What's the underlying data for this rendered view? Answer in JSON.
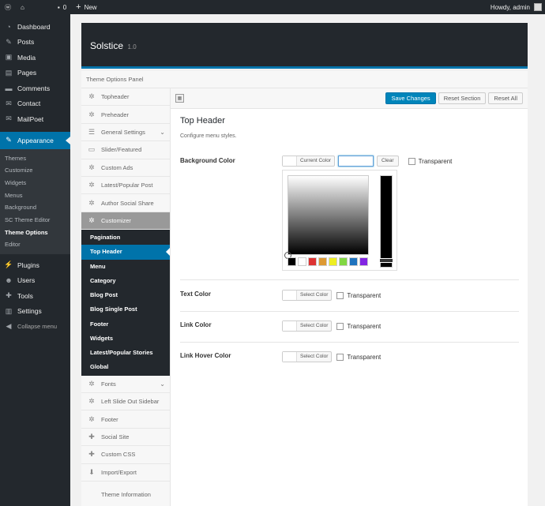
{
  "adminbar": {
    "comments_count": "0",
    "new_label": "New",
    "howdy": "Howdy, admin"
  },
  "adminmenu": {
    "top_items": [
      {
        "label": "Dashboard",
        "icon": "dashboard-icon"
      },
      {
        "label": "Posts",
        "icon": "pin-icon"
      },
      {
        "label": "Media",
        "icon": "media-icon"
      },
      {
        "label": "Pages",
        "icon": "page-icon"
      },
      {
        "label": "Comments",
        "icon": "comment-icon"
      },
      {
        "label": "Contact",
        "icon": "mail-icon"
      },
      {
        "label": "MailPoet",
        "icon": "mail-icon"
      }
    ],
    "current": {
      "label": "Appearance",
      "icon": "brush-icon"
    },
    "submenu": [
      "Themes",
      "Customize",
      "Widgets",
      "Menus",
      "Background",
      "SC Theme Editor",
      "Theme Options",
      "Editor"
    ],
    "active_submenu": "Theme Options",
    "bottom_items": [
      {
        "label": "Plugins",
        "icon": "plugin-icon"
      },
      {
        "label": "Users",
        "icon": "user-icon"
      },
      {
        "label": "Tools",
        "icon": "wrench-icon"
      },
      {
        "label": "Settings",
        "icon": "settings-icon"
      }
    ],
    "collapse": "Collapse menu"
  },
  "panel": {
    "title": "Solstice",
    "version": "1.0",
    "subtitle": "Theme Options Panel"
  },
  "options_sidebar": {
    "items_before": [
      {
        "label": "Topheader",
        "icon": "gear-icon"
      },
      {
        "label": "Preheader",
        "icon": "gear-icon"
      },
      {
        "label": "General Settings",
        "icon": "sliders-icon",
        "caret": true
      },
      {
        "label": "Slider/Featured",
        "icon": "monitor-icon"
      },
      {
        "label": "Custom Ads",
        "icon": "gear-icon"
      },
      {
        "label": "Latest/Popular Post",
        "icon": "gear-icon"
      },
      {
        "label": "Author Social Share",
        "icon": "gear-icon"
      }
    ],
    "expanded": {
      "label": "Customizer",
      "icon": "gear-icon"
    },
    "subitems": [
      "Pagination",
      "Top Header",
      "Menu",
      "Category",
      "Blog Post",
      "Blog Single Post",
      "Footer",
      "Widgets",
      "Latest/Popular Stories",
      "Global"
    ],
    "current_subitem": "Top Header",
    "items_after": [
      {
        "label": "Fonts",
        "icon": "gear-icon",
        "caret": true
      },
      {
        "label": "Left Slide Out Sidebar",
        "icon": "gear-icon"
      },
      {
        "label": "Footer",
        "icon": "gear-icon"
      },
      {
        "label": "Social Site",
        "icon": "wrench-icon"
      },
      {
        "label": "Custom CSS",
        "icon": "wrench-icon"
      },
      {
        "label": "Import/Export",
        "icon": "download-icon"
      }
    ],
    "info": "Theme Information"
  },
  "toolbar": {
    "save": "Save Changes",
    "reset_section": "Reset Section",
    "reset_all": "Reset All"
  },
  "section": {
    "title": "Top Header",
    "description": "Configure menu styles."
  },
  "fields": {
    "bg": {
      "label": "Background Color",
      "button": "Current Color",
      "clear": "Clear",
      "transparent": "Transparent",
      "hex_value": ""
    },
    "text": {
      "label": "Text Color",
      "button": "Select Color",
      "transparent": "Transparent"
    },
    "link": {
      "label": "Link Color",
      "button": "Select Color",
      "transparent": "Transparent"
    },
    "link_hover": {
      "label": "Link Hover Color",
      "button": "Select Color",
      "transparent": "Transparent"
    }
  },
  "palette": [
    "#000000",
    "#ffffff",
    "#dd3333",
    "#dd9933",
    "#eeee22",
    "#81d742",
    "#1e73be",
    "#8224e3"
  ],
  "colors": {
    "accent": "#0073aa",
    "admin_bg": "#23282d"
  }
}
